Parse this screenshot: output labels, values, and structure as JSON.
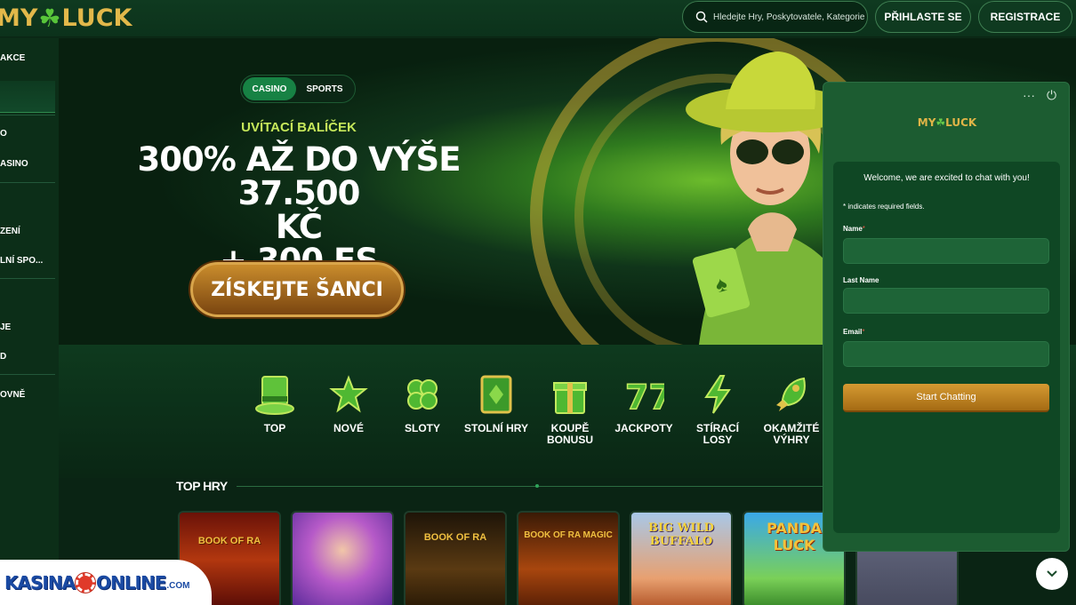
{
  "header": {
    "logo_left": "MY",
    "logo_right": "LUCK",
    "search_placeholder": "Hledejte Hry, Poskytovatele, Kategorie",
    "login_label": "PŘIHLASTE SE",
    "register_label": "REGISTRACE"
  },
  "sidebar": {
    "items": [
      "AKCE",
      "O",
      "ASINO",
      "ZENÍ",
      "LNÍ SPO...",
      "JE",
      "D",
      "OVNĚ"
    ]
  },
  "banner": {
    "tab_casino": "CASINO",
    "tab_sports": "SPORTS",
    "welcome": "UVÍTACÍ BALÍČEK",
    "headline_1": "300% AŽ DO VÝŠE 37.500",
    "headline_2": "KČ",
    "headline_3": "+ 300 FS",
    "cta": "ZÍSKEJTE ŠANCI"
  },
  "categories": [
    {
      "label": "TOP",
      "icon": "top-hat-icon"
    },
    {
      "label": "NOVÉ",
      "icon": "star-icon"
    },
    {
      "label": "SLOTY",
      "icon": "clover-icon"
    },
    {
      "label": "STOLNÍ HRY",
      "icon": "card-icon"
    },
    {
      "label": "KOUPĚ BONUSU",
      "icon": "gift-icon"
    },
    {
      "label": "JACKPOTY",
      "icon": "seven-icon"
    },
    {
      "label": "STÍRACÍ LOSY",
      "icon": "lightning-icon"
    },
    {
      "label": "OKAMŽITÉ VÝHRY",
      "icon": "rocket-icon"
    }
  ],
  "top_games": {
    "title": "TOP HRY",
    "games": [
      "BOOK OF RA",
      "",
      "BOOK OF RA",
      "BOOK OF RA MAGIC",
      "BIG WILD BUFFALO",
      "PANDA LUCK",
      ""
    ]
  },
  "chat": {
    "logo_left": "MY",
    "logo_right": "LUCK",
    "welcome": "Welcome, we are excited to chat with you!",
    "required_note": "* indicates required fields.",
    "name_label": "Name",
    "lastname_label": "Last Name",
    "email_label": "Email",
    "required_mark": "*",
    "start_button": "Start Chatting",
    "menu_glyph": "···",
    "power_glyph": "⏻"
  },
  "watermark": {
    "part1": "KASINA",
    "part2": "ONLINE",
    "part3": ".COM"
  },
  "colors": {
    "accent_green": "#178244",
    "gold": "#e2b84a",
    "chat_bg": "#1c5c31"
  }
}
